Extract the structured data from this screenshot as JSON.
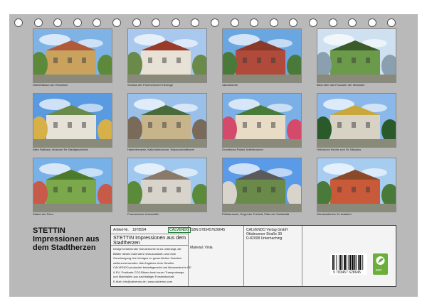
{
  "calendar": {
    "title": "STETTIN Impressionen aus dem Stadtherzen",
    "photos": [
      {
        "caption": "Giebelhäuser am Heumarkt"
      },
      {
        "caption": "Schloss der Pommerschen Herzöge"
      },
      {
        "caption": "Jakobikirche"
      },
      {
        "caption": "Blick über das Flussufer der Westoder"
      },
      {
        "caption": "Altes Rathaus, Museum für Stadtgeschichte"
      },
      {
        "caption": "Hakenterrasse, Nationalmuseum, Wojwodschaftsamt"
      },
      {
        "caption": "Grumbkow-Palast, Adlerbrunnen"
      },
      {
        "caption": "Orthodoxe Kirche zum Hl. Nikolaus"
      },
      {
        "caption": "Statue der Flora"
      },
      {
        "caption": "Pommersche Universität"
      },
      {
        "caption": "Philharmonie, Engel der Freiheit, Platz der Solidarität"
      },
      {
        "caption": "Garnisonkirche St. Adalbert"
      }
    ]
  },
  "info": {
    "article_label": "Artikel-Nr.",
    "article_no": "1978594",
    "brand": "CALVENDO",
    "isbn": "ISBN 9783457628645",
    "publisher_lines": [
      "CALVENDO Verlag GmbH",
      "Ottobrunner Straße 39",
      "D-82008 Unterhaching"
    ],
    "material": "Material: Vinla",
    "subtitle": "STETTIN Impressionen aus dem Stadtherzen",
    "notes": [
      "Infolge bestehender Schutzrechte ist es untersagt, die",
      "Blätter dieses Kalenders herauszulösen und ohne",
      "Genehmigung des Verlages zu gewerblichen Zwecken",
      "weiterzuverwenden. Alle Angaben ohne Gewähr.",
      "CALVENDO produziert bedarfsgerecht und klimaneutral in DE",
      "& EU. Postkarte CO2-Bilanz dank kurzer Transportwege",
      "und Materialien aus nachhaltiger Forstwirtschaft.",
      "E-Mail: info@calvendo.de | www.calvendo.com"
    ],
    "barcode_number": "9 783457 628645",
    "eco_label": "eco"
  }
}
